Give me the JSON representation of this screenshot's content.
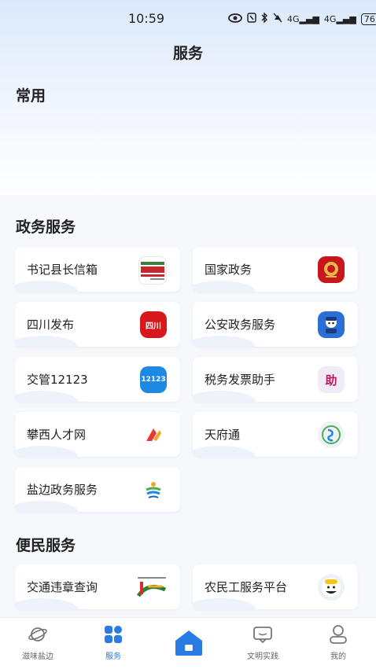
{
  "status_bar": {
    "time": "10:59",
    "signal_1": "4G",
    "signal_2": "4G",
    "battery": "76"
  },
  "header": {
    "title": "服务"
  },
  "sections": {
    "common": "常用",
    "gov": "政务服务",
    "civil": "便民服务"
  },
  "gov_services": [
    {
      "label": "书记县长信箱",
      "icon": "letterbox-logo-icon"
    },
    {
      "label": "国家政务",
      "icon": "national-emblem-icon"
    },
    {
      "label": "四川发布",
      "icon": "sichuan-fabu-icon"
    },
    {
      "label": "公安政务服务",
      "icon": "police-mascot-icon"
    },
    {
      "label": "交管12123",
      "icon": "traffic-12123-icon"
    },
    {
      "label": "税务发票助手",
      "icon": "tax-invoice-icon"
    },
    {
      "label": "攀西人才网",
      "icon": "panxi-talent-icon"
    },
    {
      "label": "天府通",
      "icon": "tianfutong-icon"
    },
    {
      "label": "盐边政务服务",
      "icon": "yanbian-gov-icon"
    }
  ],
  "civil_services": [
    {
      "label": "交通违章查询",
      "icon": "traffic-violation-icon"
    },
    {
      "label": "农民工服务平台",
      "icon": "migrant-worker-icon"
    }
  ],
  "icon_text": {
    "traffic_12123": "12123",
    "tax": "助",
    "sichuan": "四川"
  },
  "tabbar": [
    {
      "label": "滋味盐边",
      "icon": "planet-icon"
    },
    {
      "label": "服务",
      "icon": "grid-icon"
    },
    {
      "label": "",
      "icon": "home-icon"
    },
    {
      "label": "文明实践",
      "icon": "message-icon"
    },
    {
      "label": "我的",
      "icon": "user-icon"
    }
  ],
  "colors": {
    "accent": "#2a7be4",
    "tab_inactive": "#666666"
  }
}
